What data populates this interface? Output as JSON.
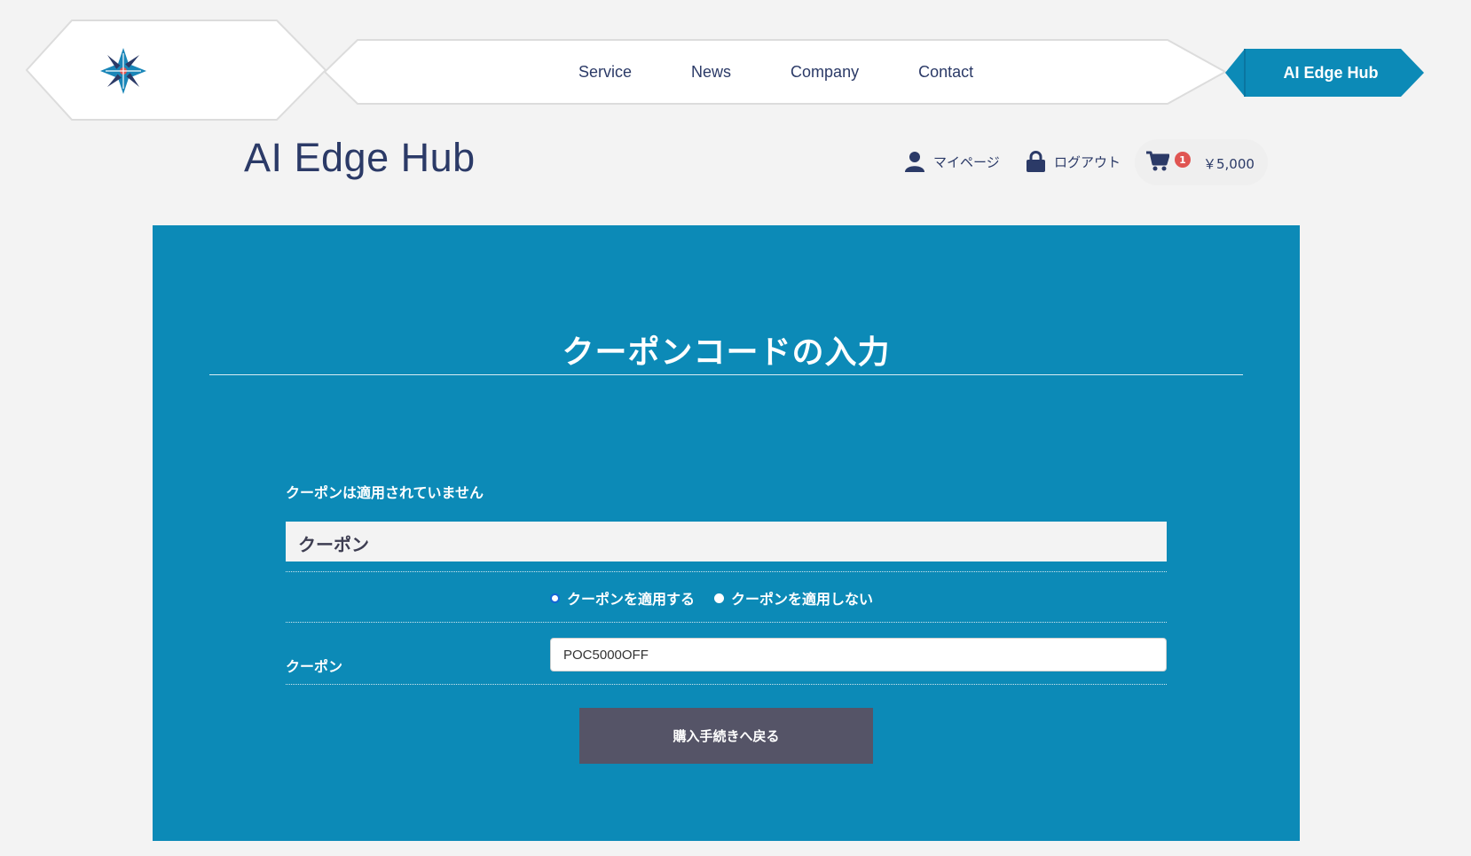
{
  "nav": {
    "items": [
      "Service",
      "News",
      "Company",
      "Contact"
    ],
    "cta_label": "AI Edge Hub"
  },
  "site_title": "AI Edge Hub",
  "utility": {
    "mypage_label": "マイページ",
    "logout_label": "ログアウト",
    "cart_count": "1",
    "cart_total": "￥5,000"
  },
  "main": {
    "title": "クーポンコードの入力",
    "status_message": "クーポンは適用されていません",
    "section_heading": "クーポン",
    "radio_options": [
      "クーポンを適用する",
      "クーポンを適用しない"
    ],
    "selected_radio": "クーポンを適用する",
    "field_label": "クーポン",
    "coupon_value": "POC5000OFF",
    "back_button_label": "購入手続きへ戻る"
  },
  "colors": {
    "brand_navy": "#2b3a67",
    "panel_blue": "#0c8ab7",
    "cta_blue": "#0c8ab7",
    "button_gray": "#555467",
    "badge_red": "#e05552"
  }
}
